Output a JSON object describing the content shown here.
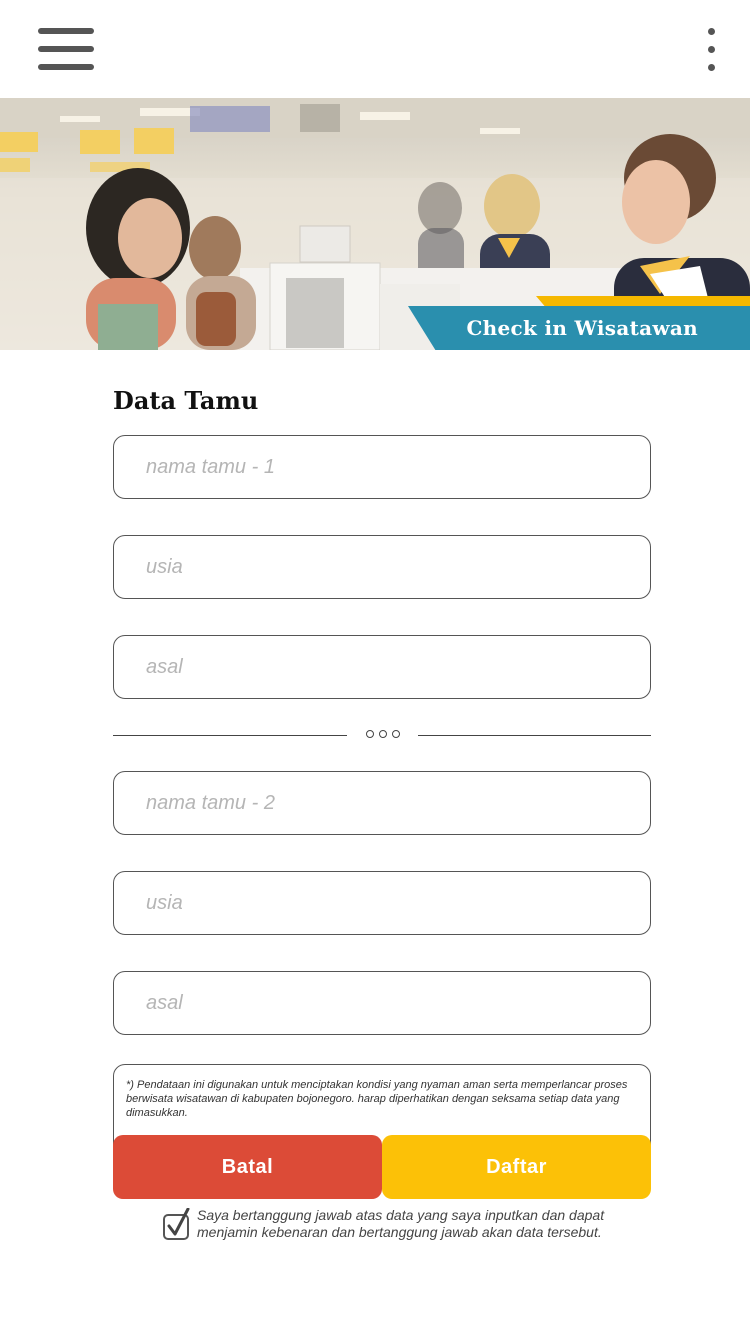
{
  "hero": {
    "label": "Check in Wisatawan"
  },
  "form": {
    "title": "Data Tamu",
    "guest1": {
      "name_placeholder": "nama tamu - 1",
      "age_placeholder": "usia",
      "origin_placeholder": "asal"
    },
    "guest2": {
      "name_placeholder": "nama tamu - 2",
      "age_placeholder": "usia",
      "origin_placeholder": "asal"
    },
    "notice": "*) Pendataan ini digunakan untuk menciptakan kondisi yang nyaman aman serta memperlancar proses berwisata wisatawan di kabupaten bojonegoro. harap diperhatikan dengan seksama setiap data yang dimasukkan."
  },
  "buttons": {
    "cancel_label": "Batal",
    "submit_label": "Daftar"
  },
  "agreement": {
    "text": "Saya bertanggung jawab atas data yang saya inputkan dan dapat menjamin kebenaran dan bertanggung jawab akan data tersebut.",
    "checked": true
  },
  "colors": {
    "banner": "#2a8fae",
    "banner_accent": "#f5b800",
    "cancel": "#dc4b37",
    "submit": "#fcc107"
  },
  "icons": {
    "menu": "hamburger-menu-icon",
    "more": "more-vertical-icon",
    "divider": "ellipsis-icon",
    "check": "checkbox-checked-icon"
  }
}
